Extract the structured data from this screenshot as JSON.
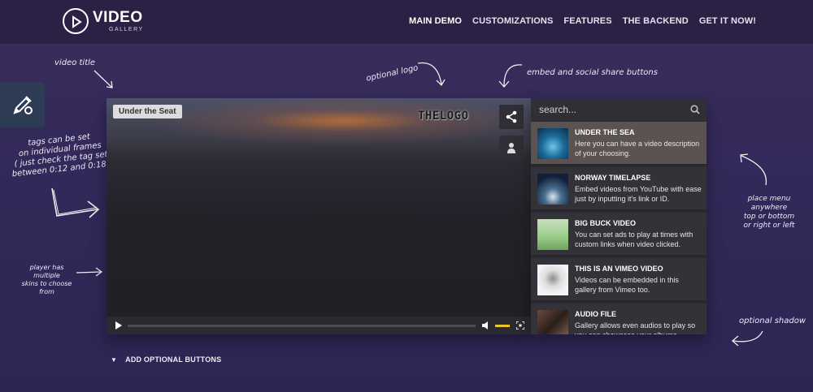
{
  "header": {
    "logo_main": "VIDEO",
    "logo_sub": "GALLERY",
    "nav": [
      "MAIN DEMO",
      "CUSTOMIZATIONS",
      "FEATURES",
      "THE BACKEND",
      "GET IT NOW!"
    ]
  },
  "annotations": {
    "video_title": "video title",
    "optional_logo": "optional logo",
    "embed_share": "embed and social share buttons",
    "tags_line1": "tags can be set",
    "tags_line2": "on individual frames",
    "tags_line3": "( just check the tag set",
    "tags_line4": "between 0:12 and 0:18 )",
    "place_line1": "place menu anywhere",
    "place_line2": "top or bottom",
    "place_line3": "or right or left",
    "skins_line1": "player has multiple",
    "skins_line2": "skins to choose",
    "skins_line3": "from",
    "shadow": "optional shadow"
  },
  "player": {
    "title": "Under the Seat",
    "logo_text": "THELOGO",
    "volume_level": 1.0,
    "progress": 0
  },
  "playlist": {
    "search_placeholder": "search...",
    "items": [
      {
        "title": "UNDER THE SEA",
        "desc": "Here you can have a video description of your choosing."
      },
      {
        "title": "NORWAY TIMELAPSE",
        "desc": "Embed videos from YouTube with ease just by inputting it's link or ID."
      },
      {
        "title": "BIG BUCK VIDEO",
        "desc": "You can set ads to play at times with custom links when video clicked."
      },
      {
        "title": "THIS IS AN VIMEO VIDEO",
        "desc": "Videos can be embedded in this gallery from Vimeo too."
      },
      {
        "title": "AUDIO FILE",
        "desc": "Gallery allows even audios to play so you can showcase your albums."
      }
    ]
  },
  "footer": {
    "add_buttons": "ADD OPTIONAL BUTTONS"
  },
  "colors": {
    "background": "#33295a",
    "header": "#2b2144",
    "accent_volume": "#e7c72a",
    "active_item": "#5b5352"
  }
}
